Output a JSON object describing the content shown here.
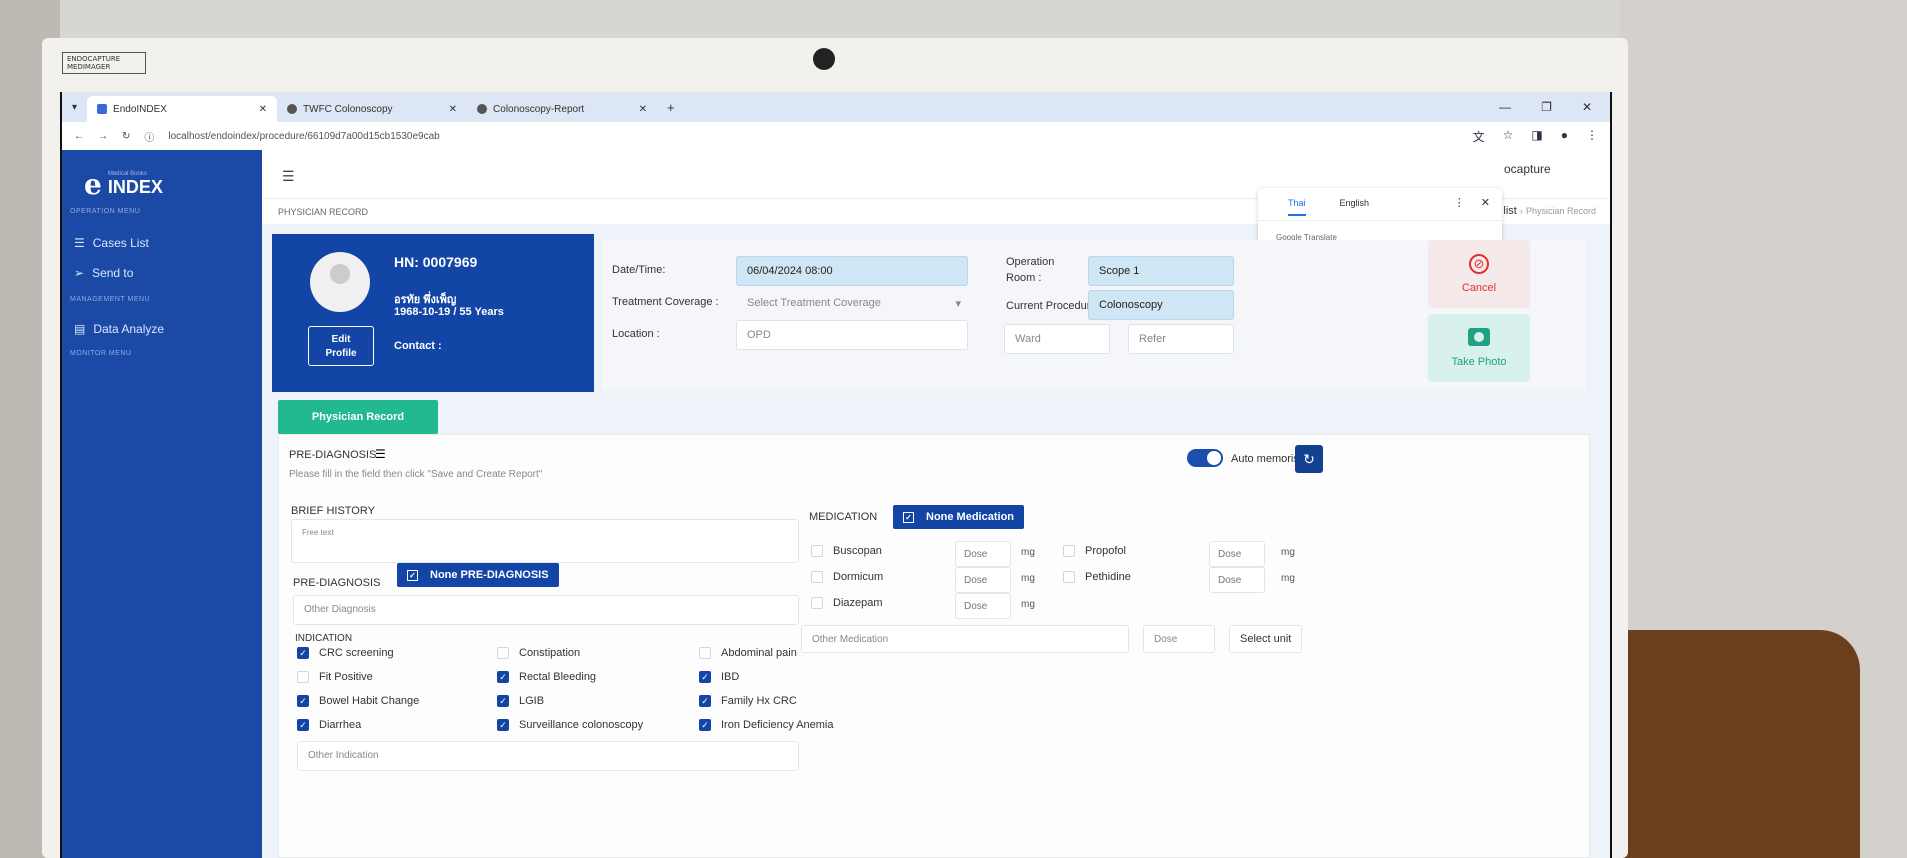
{
  "bezel": {
    "brand_line1": "ENDOCAPTURE",
    "brand_line2": "MEDIMAGER"
  },
  "browser": {
    "tabs": [
      {
        "label": "EndoINDEX"
      },
      {
        "label": "TWFC Colonoscopy"
      },
      {
        "label": "Colonoscopy-Report"
      }
    ],
    "new_tab": "+",
    "url": "localhost/endoindex/procedure/66109d7a00d15cb1530e9cab"
  },
  "translate_popup": {
    "tabs": [
      "Thai",
      "English"
    ],
    "footer": "Google Translate"
  },
  "sidebar": {
    "logo_mark": "e",
    "logo_sub": "Medical Books",
    "logo_text": "INDEX",
    "operation_menu": "OPERATION MENU",
    "items": [
      {
        "label": "Cases List"
      },
      {
        "label": "Send to"
      },
      {
        "label": "Data Analyze"
      }
    ],
    "management_menu": "MANAGEMENT MENU",
    "monitor_menu": "MONITOR MENU"
  },
  "topbar": {
    "brand": "ocapture"
  },
  "breadcrumb": {
    "page": "PHYSICIAN RECORD",
    "cases_list": "Cases list",
    "current": "Physician Record"
  },
  "patient": {
    "hn": "HN: 0007969",
    "name": "อรทัย พึ่งเพ็ญ",
    "dob_age": "1968-10-19 / 55 Years",
    "contact": "Contact :",
    "edit_line1": "Edit",
    "edit_line2": "Profile"
  },
  "info": {
    "datetime_label": "Date/Time:",
    "datetime_value": "06/04/2024 08:00",
    "coverage_label": "Treatment Coverage :",
    "coverage_placeholder": "Select Treatment Coverage",
    "location_label": "Location :",
    "location_value": "OPD",
    "room_label_1": "Operation",
    "room_label_2": "Room :",
    "room_value": "Scope 1",
    "procedure_label": "Current Procedure",
    "procedure_value": "Colonoscopy",
    "ward_placeholder": "Ward",
    "refer_placeholder": "Refer",
    "cancel_label": "Cancel",
    "photo_label": "Take Photo"
  },
  "tab_physician": "Physician Record",
  "prediag": {
    "title": "PRE-DIAGNOSIS",
    "hint": "Please fill in the field then click \"Save and Create Report\"",
    "auto_memorise": "Auto memorise",
    "brief_history": "BRIEF HISTORY",
    "free_text": "Free text",
    "pre_diagnosis": "PRE-DIAGNOSIS",
    "none_prediag": "None PRE-DIAGNOSIS",
    "other_diagnosis": "Other Diagnosis",
    "indication": "INDICATION",
    "indications": [
      {
        "label": "CRC screening",
        "checked": true
      },
      {
        "label": "Constipation",
        "checked": false
      },
      {
        "label": "Abdominal pain",
        "checked": false
      },
      {
        "label": "Fit Positive",
        "checked": false
      },
      {
        "label": "Rectal Bleeding",
        "checked": true
      },
      {
        "label": "IBD",
        "checked": true
      },
      {
        "label": "Bowel Habit Change",
        "checked": true
      },
      {
        "label": "LGIB",
        "checked": true
      },
      {
        "label": "Family Hx CRC",
        "checked": true
      },
      {
        "label": "Diarrhea",
        "checked": true
      },
      {
        "label": "Surveillance colonoscopy",
        "checked": true
      },
      {
        "label": "Iron Deficiency Anemia",
        "checked": true
      }
    ],
    "other_indication": "Other Indication"
  },
  "medication": {
    "title": "MEDICATION",
    "none_label": "None Medication",
    "drugs": [
      {
        "label": "Buscopan",
        "dose": "Dose",
        "unit": "mg"
      },
      {
        "label": "Propofol",
        "dose": "Dose",
        "unit": "mg"
      },
      {
        "label": "Dormicum",
        "dose": "Dose",
        "unit": "mg"
      },
      {
        "label": "Pethidine",
        "dose": "Dose",
        "unit": "mg"
      },
      {
        "label": "Diazepam",
        "dose": "Dose",
        "unit": "mg"
      }
    ],
    "other_medication": "Other Medication",
    "other_dose": "Dose",
    "select_unit": "Select unit"
  }
}
